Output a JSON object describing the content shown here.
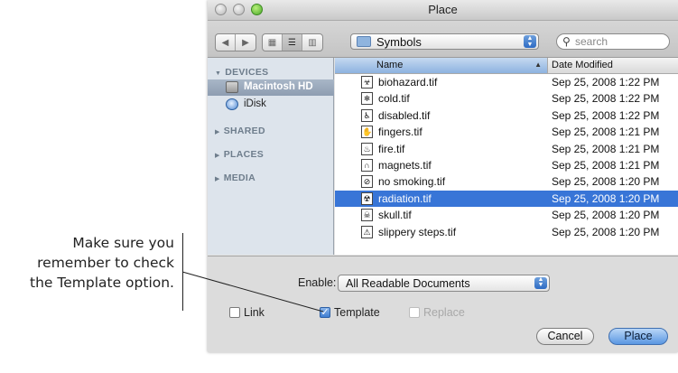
{
  "callout": {
    "line1": "Make sure you",
    "line2": "remember to check",
    "line3": "the Template option."
  },
  "window": {
    "title": "Place",
    "traffic_lights": [
      "close-button",
      "minimize-button",
      "zoom-button"
    ]
  },
  "toolbar": {
    "back_icon": "triangle-left",
    "forward_icon": "triangle-right",
    "view_modes": [
      "icon-view",
      "list-view",
      "column-view"
    ],
    "active_view": "list-view",
    "location": "Symbols",
    "search_placeholder": "search"
  },
  "sidebar": {
    "devices_label": "DEVICES",
    "devices": [
      {
        "label": "Macintosh HD",
        "icon": "hard-drive-icon",
        "selected": true
      },
      {
        "label": "iDisk",
        "icon": "idisk-icon",
        "selected": false
      }
    ],
    "shared_label": "SHARED",
    "places_label": "PLACES",
    "media_label": "MEDIA"
  },
  "columns": {
    "name": "Name",
    "date": "Date Modified"
  },
  "files": [
    {
      "name": "biohazard.tif",
      "date": "Sep 25, 2008 1:22 PM",
      "icon": "biohazard-icon",
      "glyph": "☣",
      "selected": false
    },
    {
      "name": "cold.tif",
      "date": "Sep 25, 2008 1:22 PM",
      "icon": "snowflake-icon",
      "glyph": "❄",
      "selected": false
    },
    {
      "name": "disabled.tif",
      "date": "Sep 25, 2008 1:22 PM",
      "icon": "wheelchair-icon",
      "glyph": "♿",
      "selected": false
    },
    {
      "name": "fingers.tif",
      "date": "Sep 25, 2008 1:21 PM",
      "icon": "hand-icon",
      "glyph": "✋",
      "selected": false
    },
    {
      "name": "fire.tif",
      "date": "Sep 25, 2008 1:21 PM",
      "icon": "flame-icon",
      "glyph": "♨",
      "selected": false
    },
    {
      "name": "magnets.tif",
      "date": "Sep 25, 2008 1:21 PM",
      "icon": "magnet-icon",
      "glyph": "∩",
      "selected": false
    },
    {
      "name": "no smoking.tif",
      "date": "Sep 25, 2008 1:20 PM",
      "icon": "no-smoking-icon",
      "glyph": "⊘",
      "selected": false
    },
    {
      "name": "radiation.tif",
      "date": "Sep 25, 2008 1:20 PM",
      "icon": "radiation-icon",
      "glyph": "☢",
      "selected": true
    },
    {
      "name": "skull.tif",
      "date": "Sep 25, 2008 1:20 PM",
      "icon": "skull-icon",
      "glyph": "☠",
      "selected": false
    },
    {
      "name": "slippery steps.tif",
      "date": "Sep 25, 2008 1:20 PM",
      "icon": "slippery-steps-icon",
      "glyph": "⚠",
      "selected": false
    }
  ],
  "options": {
    "enable_label": "Enable:",
    "enable_value": "All Readable Documents",
    "link_label": "Link",
    "link_checked": false,
    "template_label": "Template",
    "template_checked": true,
    "replace_label": "Replace",
    "replace_checked": false,
    "replace_enabled": false
  },
  "buttons": {
    "cancel": "Cancel",
    "place": "Place"
  },
  "colors": {
    "selection": "#3875d7",
    "sidebar_bg": "#dde4ec",
    "default_button": "#5a97e2"
  }
}
